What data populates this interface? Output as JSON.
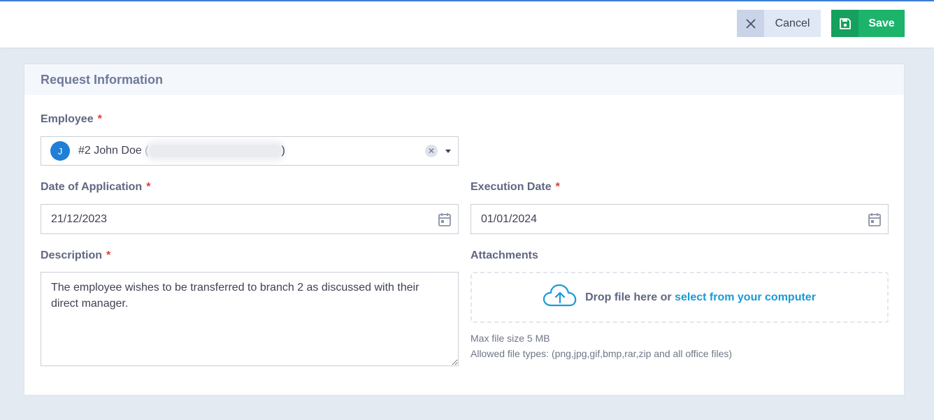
{
  "toolbar": {
    "cancel_label": "Cancel",
    "save_label": "Save"
  },
  "card": {
    "title": "Request Information"
  },
  "form": {
    "employee": {
      "label": "Employee",
      "required_mark": "*",
      "avatar_initial": "J",
      "value_prefix": "#2 John Doe (",
      "value_suffix": ")"
    },
    "date_of_application": {
      "label": "Date of Application",
      "required_mark": "*",
      "value": "21/12/2023"
    },
    "execution_date": {
      "label": "Execution Date",
      "required_mark": "*",
      "value": "01/01/2024"
    },
    "description": {
      "label": "Description",
      "required_mark": "*",
      "value": "The employee wishes to be transferred to branch 2 as discussed with their direct manager."
    },
    "attachments": {
      "label": "Attachments",
      "drop_text": "Drop file here or",
      "select_link": "select from your computer",
      "max_size": "Max file size 5 MB",
      "allowed_types": "Allowed file types: (png,jpg,gif,bmp,rar,zip and all office files)"
    }
  },
  "colors": {
    "accent_blue": "#1a9ad6",
    "save_green": "#1cb36b",
    "required_red": "#e53935",
    "page_bg": "#e4eaf2"
  },
  "icons": [
    "close-icon",
    "save-icon",
    "calendar-icon",
    "cloud-upload-icon",
    "chevron-down-icon"
  ]
}
